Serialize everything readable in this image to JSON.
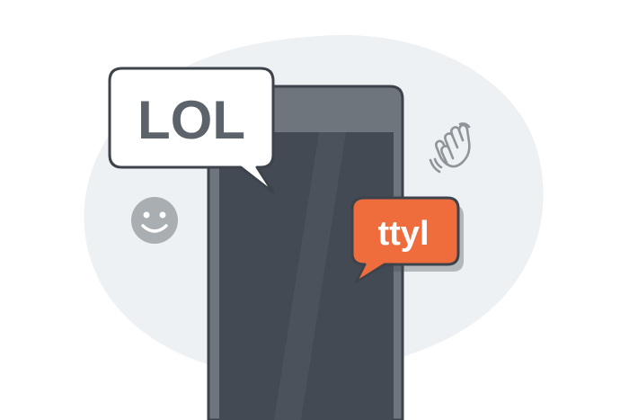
{
  "illustration": {
    "bubble_left": {
      "text": "LOL",
      "text_color": "#5c636b",
      "fill": "#ffffff",
      "stroke": "#3d434b"
    },
    "bubble_right": {
      "text": "ttyl",
      "text_color": "#ffffff",
      "fill": "#ef6c3c",
      "stroke": "#3d434b"
    },
    "icons": [
      "smiley-face-icon",
      "waving-hand-icon"
    ],
    "colors": {
      "background_blob": "#eef1f4",
      "phone_body": "#6e757d",
      "phone_screen": "#434a53",
      "outline": "#3d434b",
      "icon_gray": "#a9aeb3"
    }
  }
}
